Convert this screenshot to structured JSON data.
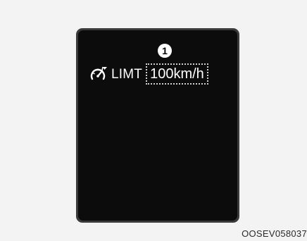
{
  "display": {
    "icon": "speedometer-limit-icon",
    "limit_label": "LIMT",
    "speed_value": "100km/h",
    "callout_number": "1",
    "colors": {
      "screen": "#0c0c0c",
      "bezel": "#3a3a3a",
      "text": "#ffffff",
      "background": "#f3f3f3"
    }
  },
  "figure_code": "OOSEV058037"
}
